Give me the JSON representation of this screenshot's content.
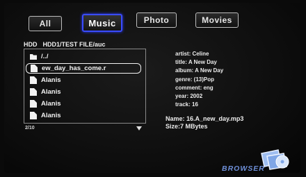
{
  "tabs": [
    {
      "label": "All"
    },
    {
      "label": "Music"
    },
    {
      "label": "Photo"
    },
    {
      "label": "Movies"
    }
  ],
  "active_tab": "Music",
  "path": {
    "drive": "HDD",
    "location": "HDD1/TEST FILE/auc"
  },
  "files": [
    {
      "label": "/../",
      "type": "folder-up"
    },
    {
      "label": "ew_day_has_come.r",
      "type": "file"
    },
    {
      "label": "Alanis",
      "type": "file"
    },
    {
      "label": "Alanis",
      "type": "file"
    },
    {
      "label": "Alanis",
      "type": "file"
    },
    {
      "label": "Alanis",
      "type": "file"
    }
  ],
  "pager": "2/10",
  "metadata": {
    "artist": "artist: Celine",
    "title": "title: A New Day",
    "album": "album: A New Day",
    "genre": "genre: (13)Pop",
    "comment": "comment: eng",
    "year": "year: 2002",
    "track": "track: 16"
  },
  "file_info": {
    "name": "Name: 16.A_new_day.mp3",
    "size": "Size:7 MBytes"
  },
  "brand": "BROWSER",
  "colors": {
    "accent": "#3a4cff",
    "brand": "#6e8fd8"
  }
}
